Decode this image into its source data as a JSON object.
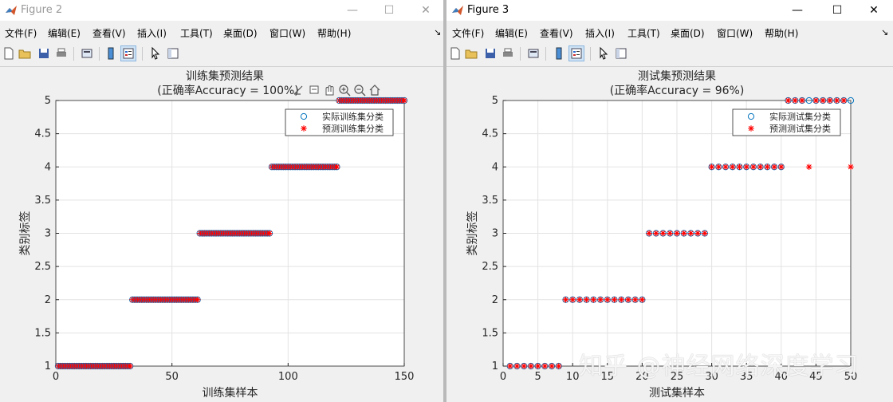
{
  "windows": [
    {
      "id": "left",
      "title": "Figure 2",
      "menu": [
        "文件(F)",
        "编辑(E)",
        "查看(V)",
        "插入(I)",
        "工具(T)",
        "桌面(D)",
        "窗口(W)",
        "帮助(H)"
      ],
      "window_controls": {
        "minimize": "—",
        "maximize": "☐",
        "close": "✕"
      }
    },
    {
      "id": "right",
      "title": "Figure 3",
      "menu": [
        "文件(F)",
        "编辑(E)",
        "查看(V)",
        "插入(I)",
        "工具(T)",
        "桌面(D)",
        "窗口(W)",
        "帮助(H)"
      ],
      "window_controls": {
        "minimize": "—",
        "maximize": "☐",
        "close": "✕"
      }
    }
  ],
  "toolbar_icons": [
    "new-file-icon",
    "open-folder-icon",
    "save-icon",
    "print-icon",
    "print-preview-icon",
    "colorbar-icon",
    "legend-icon",
    "pointer-icon",
    "property-editor-icon"
  ],
  "axes_toolbar_icons": [
    "brush-icon",
    "data-tip-icon",
    "pan-hand-icon",
    "zoom-in-icon",
    "zoom-out-icon",
    "home-icon"
  ],
  "watermark": "知乎 @神经网络深度学习",
  "colors": {
    "actual_marker": "#0072bd",
    "predicted_marker": "#ff0000"
  },
  "chart_data": [
    {
      "type": "scatter",
      "title": "训练集预测结果",
      "subtitle": "(正确率Accuracy = 100%)",
      "xlabel": "训练集样本",
      "ylabel": "类别标签",
      "xlim": [
        0,
        150
      ],
      "ylim": [
        1,
        5
      ],
      "xticks": [
        0,
        50,
        100,
        150
      ],
      "yticks": [
        1,
        1.5,
        2,
        2.5,
        3,
        3.5,
        4,
        4.5,
        5
      ],
      "grid": true,
      "legend_position": "top-right",
      "segments": [
        {
          "x_from": 1,
          "x_to": 32,
          "class": 1
        },
        {
          "x_from": 33,
          "x_to": 61,
          "class": 2
        },
        {
          "x_from": 62,
          "x_to": 92,
          "class": 3
        },
        {
          "x_from": 93,
          "x_to": 121,
          "class": 4
        },
        {
          "x_from": 122,
          "x_to": 150,
          "class": 5
        }
      ],
      "series": [
        {
          "name": "实际训练集分类",
          "marker": "o",
          "mispredicted": []
        },
        {
          "name": "预测训练集分类",
          "marker": "*",
          "mispredicted": []
        }
      ]
    },
    {
      "type": "scatter",
      "title": "测试集预测结果",
      "subtitle": "(正确率Accuracy = 96%)",
      "xlabel": "测试集样本",
      "ylabel": "类别标签",
      "xlim": [
        0,
        50
      ],
      "ylim": [
        1,
        5
      ],
      "xticks": [
        0,
        5,
        10,
        15,
        20,
        25,
        30,
        35,
        40,
        45,
        50
      ],
      "yticks": [
        1,
        1.5,
        2,
        2.5,
        3,
        3.5,
        4,
        4.5,
        5
      ],
      "grid": true,
      "legend_position": "top-right",
      "segments": [
        {
          "x_from": 1,
          "x_to": 8,
          "class": 1
        },
        {
          "x_from": 9,
          "x_to": 20,
          "class": 2
        },
        {
          "x_from": 21,
          "x_to": 29,
          "class": 3
        },
        {
          "x_from": 30,
          "x_to": 40,
          "class": 4
        },
        {
          "x_from": 41,
          "x_to": 50,
          "class": 5
        }
      ],
      "series": [
        {
          "name": "实际测试集分类",
          "marker": "o",
          "mispredicted": []
        },
        {
          "name": "预测测试集分类",
          "marker": "*",
          "mispredicted": [
            {
              "x": 44,
              "y": 4
            },
            {
              "x": 50,
              "y": 4
            }
          ]
        }
      ]
    }
  ]
}
